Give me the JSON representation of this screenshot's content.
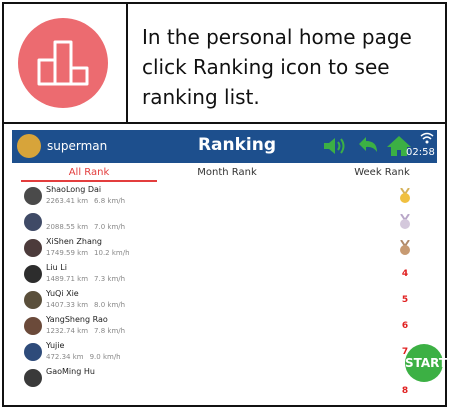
{
  "instruction": {
    "line1": "In the personal home page",
    "line2": "click Ranking icon to see",
    "line3": "ranking list."
  },
  "header": {
    "username": "superman",
    "title": "Ranking",
    "time": "02:58"
  },
  "tabs": {
    "all": "All Rank",
    "month": "Month Rank",
    "week": "Week Rank"
  },
  "rankings": [
    {
      "name": "ShaoLong Dai",
      "distance": "2263.41 km",
      "speed": "6.8 km/h",
      "rank": "1",
      "medal": "gold",
      "avatar": "#4a4a4a"
    },
    {
      "name": "",
      "distance": "2088.55 km",
      "speed": "7.0 km/h",
      "rank": "2",
      "medal": "silver",
      "avatar": "#3f4a66"
    },
    {
      "name": "XiShen Zhang",
      "distance": "1749.59 km",
      "speed": "10.2 km/h",
      "rank": "3",
      "medal": "bronze",
      "avatar": "#4c3b3b"
    },
    {
      "name": "Liu Li",
      "distance": "1489.71 km",
      "speed": "7.3 km/h",
      "rank": "4",
      "medal": "",
      "avatar": "#2d2d2d"
    },
    {
      "name": "YuQi Xie",
      "distance": "1407.33 km",
      "speed": "8.0 km/h",
      "rank": "5",
      "medal": "",
      "avatar": "#5a4f3b"
    },
    {
      "name": "YangSheng Rao",
      "distance": "1232.74 km",
      "speed": "7.8 km/h",
      "rank": "6",
      "medal": "",
      "avatar": "#6b4a3a"
    },
    {
      "name": "Yujie",
      "distance": "472.34 km",
      "speed": "9.0 km/h",
      "rank": "7",
      "medal": "",
      "avatar": "#2e4b7a"
    },
    {
      "name": "GaoMing Hu",
      "distance": "",
      "speed": "",
      "rank": "8",
      "medal": "",
      "avatar": "#3a3a3a"
    }
  ],
  "start_label": "START",
  "colors": {
    "appbar": "#1d4f8d",
    "accent_red": "#e33d3d",
    "icon_green": "#3cb044",
    "icon_bg": "#ec6b70"
  },
  "icons": {
    "podium": "podium-icon",
    "speaker": "speaker-icon",
    "back": "back-arrow-icon",
    "home": "home-icon",
    "wifi": "wifi-icon"
  }
}
